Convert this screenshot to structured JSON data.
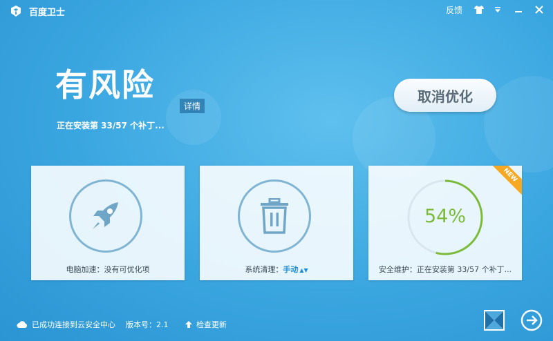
{
  "app": {
    "title": "百度卫士"
  },
  "titlebar": {
    "feedback_label": "反馈"
  },
  "status": {
    "title": "有风险",
    "detail_label": "详情",
    "subtitle": "正在安装第 33/57 个补丁..."
  },
  "actions": {
    "cancel_label": "取消优化"
  },
  "cards": {
    "speedup": {
      "label": "电脑加速：没有可优化项"
    },
    "clean": {
      "label_prefix": "系统清理：",
      "mode": "手动"
    },
    "maintain": {
      "ribbon": "NEW",
      "progress_text": "54%",
      "progress": 0.54,
      "label": "安全维护：正在安装第 33/57 个补丁..."
    }
  },
  "footer": {
    "cloud_status": "已成功连接到云安全中心",
    "version": "版本号：2.1",
    "check_update": "检查更新"
  },
  "colors": {
    "accent": "#3aa6e0",
    "progress_green": "#7cbb3a",
    "ribbon_orange": "#f7a823"
  }
}
